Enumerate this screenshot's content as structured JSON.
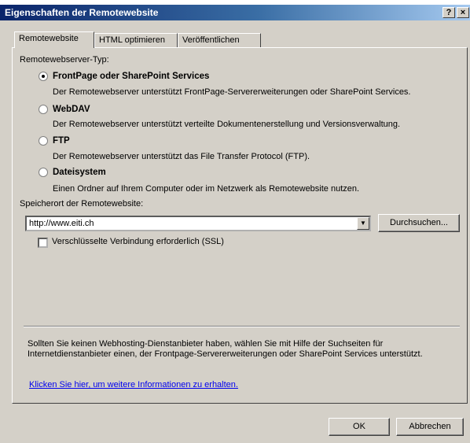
{
  "window": {
    "title": "Eigenschaften der Remotewebsite",
    "help_label": "?",
    "close_label": "×"
  },
  "tabs": [
    {
      "label": "Remotewebsite"
    },
    {
      "label": "HTML optimieren"
    },
    {
      "label": "Veröffentlichen"
    }
  ],
  "server_type": {
    "label": "Remotewebserver-Typ:",
    "options": [
      {
        "label": "FrontPage oder SharePoint Services",
        "description": "Der Remotewebserver unterstützt FrontPage-Servererweiterungen oder SharePoint Services.",
        "checked": true
      },
      {
        "label": "WebDAV",
        "description": "Der Remotewebserver unterstützt verteilte Dokumentenerstellung und Versionsverwaltung.",
        "checked": false
      },
      {
        "label": "FTP",
        "description": "Der Remotewebserver unterstützt das File Transfer Protocol (FTP).",
        "checked": false
      },
      {
        "label": "Dateisystem",
        "description": "Einen Ordner auf Ihrem Computer oder im Netzwerk als Remotewebsite nutzen.",
        "checked": false
      }
    ]
  },
  "location": {
    "label": "Speicherort der Remotewebsite:",
    "value": "http://www.eiti.ch",
    "browse_label": "Durchsuchen...",
    "ssl_label": "Verschlüsselte Verbindung erforderlich (SSL)",
    "ssl_checked": false
  },
  "info": {
    "text": "Sollten Sie keinen Webhosting-Dienstanbieter haben, wählen Sie mit Hilfe der Suchseiten für Internetdienstanbieter einen, der Frontpage-Servererweiterungen oder SharePoint Services unterstützt.",
    "link": "Klicken Sie hier, um weitere Informationen zu erhalten."
  },
  "buttons": {
    "ok": "OK",
    "cancel": "Abbrechen"
  }
}
